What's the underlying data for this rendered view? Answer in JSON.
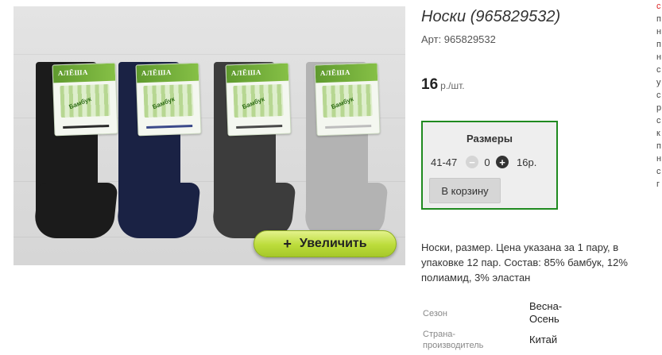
{
  "product": {
    "title": "Носки (965829532)",
    "article": "Арт: 965829532",
    "price_value": "16",
    "price_unit": "р./шт."
  },
  "photo": {
    "zoom_label": "Увеличить",
    "socks": [
      {
        "color": "#1b1b1b",
        "stripe": "#2b2b2b"
      },
      {
        "color": "#1a2244",
        "stripe": "#3b4a8a"
      },
      {
        "color": "#3c3c3c",
        "stripe": "#4a4a4a"
      },
      {
        "color": "#b3b3b3",
        "stripe": "#bdbdbd"
      }
    ],
    "card_brand": "АЛЁША",
    "card_label": "Бамбук"
  },
  "sizes": {
    "title": "Размеры",
    "size": "41-47",
    "minus_icon": "−",
    "qty": "0",
    "plus_icon": "+",
    "line_price": "16р.",
    "cart_label": "В корзину"
  },
  "description": "Носки, размер. Цена указана за 1 пару, в упаковке 12 пар. Состав: 85% бамбук, 12% полиамид, 3% эластан",
  "properties": [
    {
      "key": "Сезон",
      "value": "Весна-Осень"
    },
    {
      "key": "Страна-производитель",
      "value": "Китай"
    }
  ],
  "side_text_fragments": [
    "с",
    "п",
    "н",
    "п",
    "н",
    "с",
    "у",
    "с",
    "р",
    "с",
    "к",
    "п",
    "н",
    "с",
    "г"
  ],
  "colors": {
    "accent_green": "#1f8a1f",
    "zoom_button": "#bcdc3a"
  }
}
